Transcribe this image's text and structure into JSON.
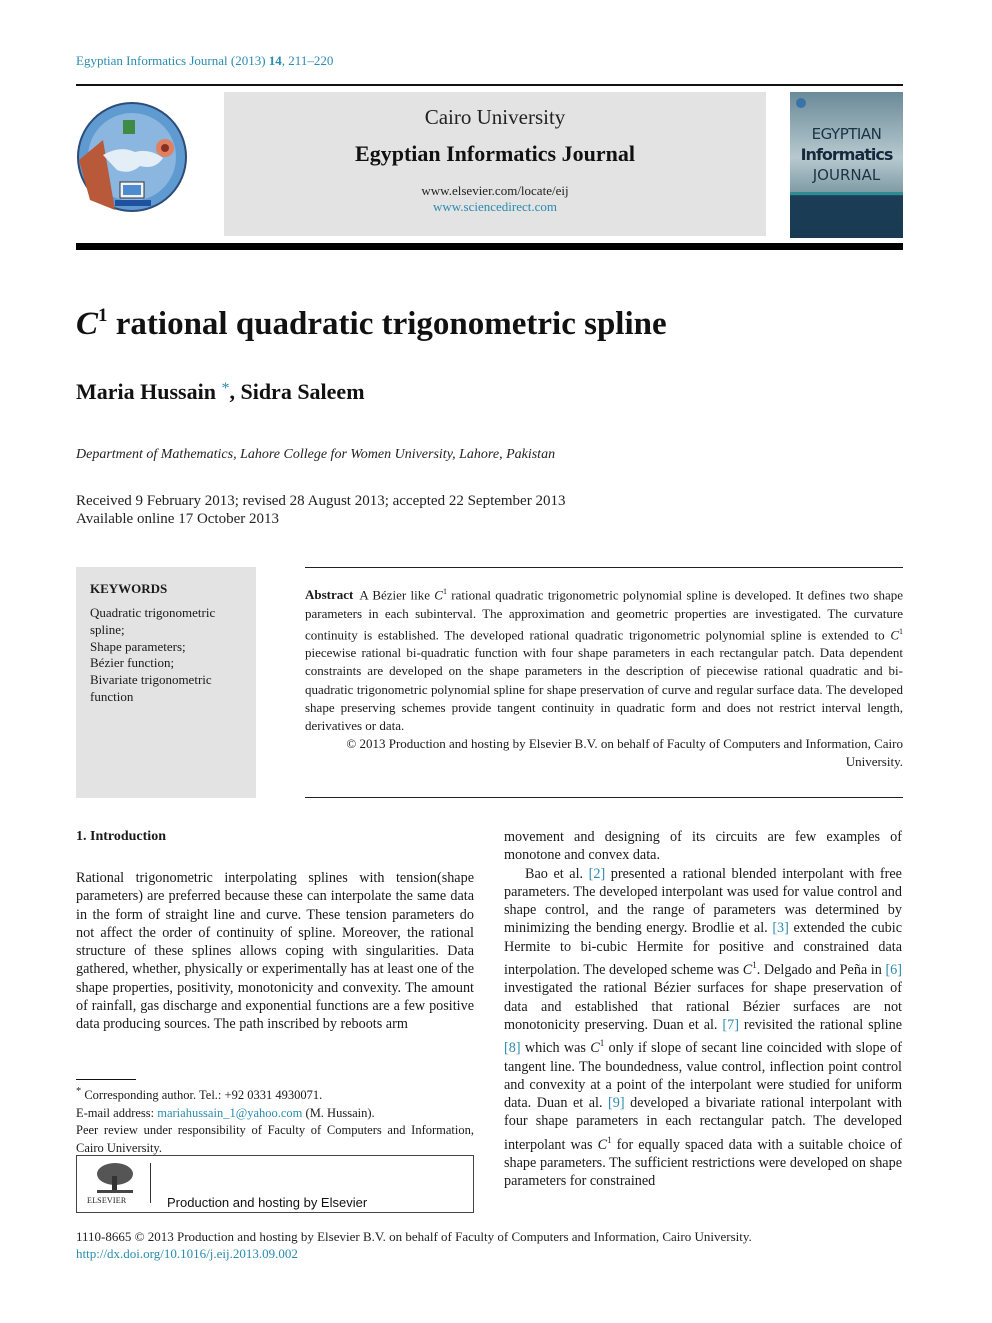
{
  "header": {
    "journal_ref_pre": "Egyptian Informatics Journal (2013) ",
    "journal_ref_vol": "14",
    "journal_ref_pages": ", 211–220",
    "university": "Cairo University",
    "journal_name": "Egyptian Informatics Journal",
    "url_locate": "www.elsevier.com/locate/eij",
    "url_sciencedirect": "www.sciencedirect.com",
    "cover": {
      "line1": "EGYPTIAN",
      "line2": "Informatics",
      "line3": "JOURNAL"
    }
  },
  "article": {
    "title_symbol": "C",
    "title_sup": "1",
    "title_rest": " rational quadratic trigonometric spline",
    "author1": "Maria Hussain",
    "author_star": "*",
    "author2": ", Sidra Saleem",
    "affiliation": "Department of Mathematics, Lahore College for Women University, Lahore, Pakistan",
    "received": "Received 9 February 2013; revised 28 August 2013; accepted 22 September 2013",
    "available": "Available online 17 October 2013"
  },
  "keywords": {
    "title": "KEYWORDS",
    "items": [
      "Quadratic trigonometric spline;",
      "Shape parameters;",
      "Bézier function;",
      "Bivariate trigonometric function"
    ]
  },
  "abstract": {
    "label": "Abstract",
    "p1": "A Bézier like ",
    "c": "C",
    "one": "1",
    "p2": " rational quadratic trigonometric polynomial spline is developed. It defines two shape parameters in each subinterval. The approximation and geometric properties are investigated. The curvature continuity is established. The developed rational quadratic trigonometric polynomial spline is extended to ",
    "p3": " piecewise rational bi-quadratic function with four shape parameters in each rectangular patch. Data dependent constraints are developed on the shape parameters in the description of piecewise rational quadratic and bi-quadratic trigonometric polynomial spline for shape preservation of curve and regular surface data. The developed shape preserving schemes provide tangent continuity in quadratic form and does not restrict interval length, derivatives or data.",
    "copyright": "© 2013 Production and hosting by Elsevier B.V. on behalf of Faculty of Computers and Information, Cairo University."
  },
  "intro": {
    "heading": "1. Introduction",
    "left_para": "Rational trigonometric interpolating splines with tension(shape parameters) are preferred because these can interpolate the same data in the form of straight line and curve. These tension parameters do not affect the order of continuity of spline. Moreover, the rational structure of these splines allows coping with singularities. Data gathered, whether, physically or experimentally has at least one of the shape properties, positivity, monotonicity and convexity. The amount of rainfall, gas discharge and exponential functions are a few positive data producing sources. The path inscribed by reboots arm",
    "right_p1": "movement and designing of its circuits are few examples of monotone and convex data.",
    "r_a": "Bao et al. ",
    "ref2": "[2]",
    "r_b": " presented a rational blended interpolant with free parameters. The developed interpolant was used for value control and shape control, and the range of parameters was determined by minimizing the bending energy. Brodlie et al. ",
    "ref3": "[3]",
    "r_c": " extended the cubic Hermite to bi-cubic Hermite for positive and constrained data interpolation. The developed scheme was ",
    "r_d": ". Delgado and Peña in ",
    "ref6": "[6]",
    "r_e": " investigated the rational Bézier surfaces for shape preservation of data and established that rational Bézier surfaces are not monotonicity preserving. Duan et al. ",
    "ref7": "[7]",
    "r_f": " revisited the rational spline ",
    "ref8": "[8]",
    "r_g": " which was ",
    "r_h": " only if slope of secant line coincided with slope of tangent line. The boundedness, value control, inflection point control and convexity at a point of the interpolant were studied for uniform data. Duan et al. ",
    "ref9": "[9]",
    "r_i": " developed a bivariate rational interpolant with four shape parameters in each rectangular patch. The developed interpolant was ",
    "r_j": " for equally spaced data with a suitable choice of shape parameters. The sufficient restrictions were developed on shape parameters for constrained"
  },
  "footnotes": {
    "star": "*",
    "corresponding": " Corresponding author. Tel.: +92 0331 4930071.",
    "email_label": "E-mail address: ",
    "email": "mariahussain_1@yahoo.com",
    "email_after": " (M. Hussain).",
    "peer_review": "Peer review under responsibility of Faculty of Computers and Information, Cairo University.",
    "elsevier_label": "ELSEVIER",
    "production": "Production and hosting by Elsevier"
  },
  "bottom": {
    "issn_line": "1110-8665 © 2013 Production and hosting by Elsevier B.V. on behalf of Faculty of Computers and Information, Cairo University.",
    "doi": "http://dx.doi.org/10.1016/j.eij.2013.09.002"
  }
}
